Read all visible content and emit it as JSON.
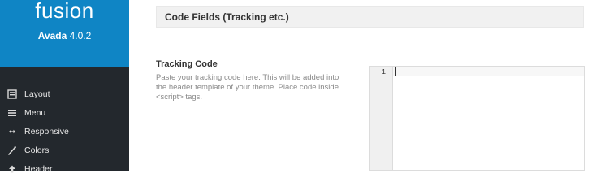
{
  "sidebar": {
    "logo": "fusion",
    "version_label": "Avada",
    "version_number": "4.0.2",
    "items": [
      {
        "label": "Layout",
        "icon": "layout-icon"
      },
      {
        "label": "Menu",
        "icon": "menu-icon"
      },
      {
        "label": "Responsive",
        "icon": "responsive-icon"
      },
      {
        "label": "Colors",
        "icon": "colors-icon"
      },
      {
        "label": "Header",
        "icon": "header-icon"
      }
    ]
  },
  "main": {
    "section_title": "Code Fields (Tracking etc.)",
    "tracking_code": {
      "label": "Tracking Code",
      "description": "Paste your tracking code here. This will be added into the header template of your theme. Place code inside <script> tags.",
      "editor": {
        "line_number": "1",
        "value": ""
      }
    }
  }
}
